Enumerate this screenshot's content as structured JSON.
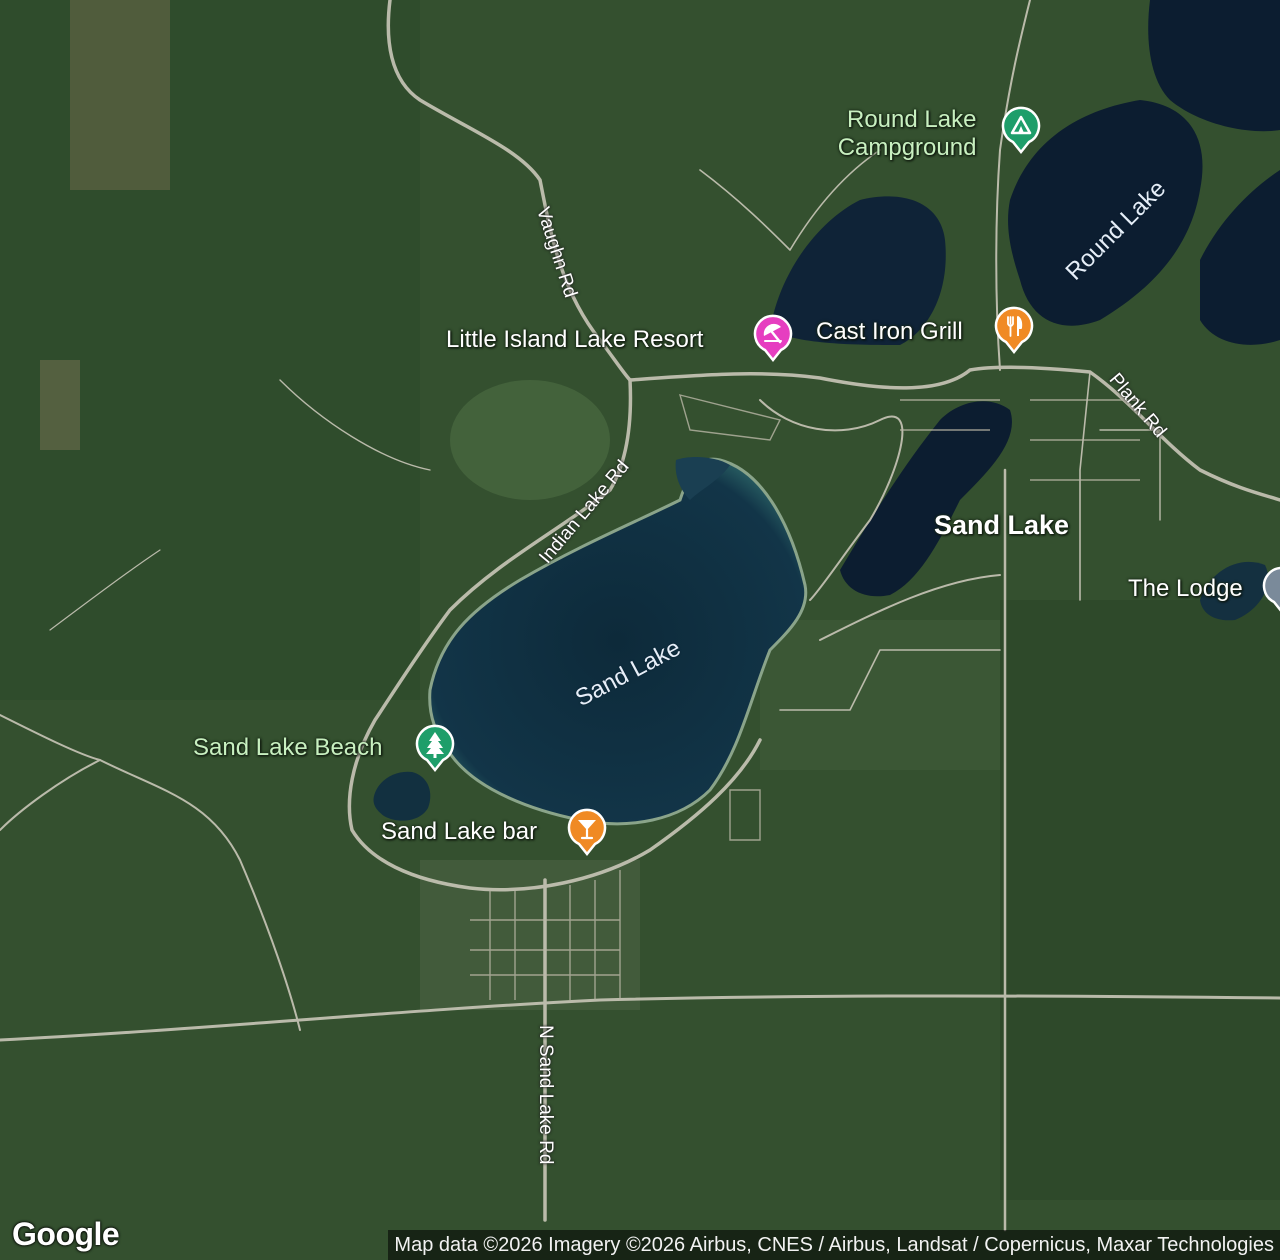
{
  "map": {
    "places": {
      "round_lake_campground_line1": "Round Lake",
      "round_lake_campground_line2": "Campground",
      "little_island_lake_resort": "Little Island Lake Resort",
      "cast_iron_grill": "Cast Iron Grill",
      "sand_lake_town": "Sand Lake",
      "the_lodge": "The Lodge",
      "sand_lake_beach": "Sand Lake Beach",
      "sand_lake_bar": "Sand Lake bar"
    },
    "lakes": {
      "sand_lake": "Sand Lake",
      "round_lake": "Round Lake"
    },
    "roads": {
      "vaughn_rd": "Vaughn Rd",
      "indian_lake_rd": "Indian Lake Rd",
      "plank_rd": "Plank Rd",
      "n_sand_lake_rd": "N Sand Lake Rd"
    },
    "pin_colors": {
      "campground": "#1e9e6a",
      "resort": "#e63ec0",
      "restaurant": "#f08a24",
      "park": "#1e9e6a",
      "bar": "#f08a24",
      "lodging": "#7a8a9a"
    },
    "icons": {
      "campground": "tent-icon",
      "resort": "resort-icon",
      "restaurant": "fork-knife-icon",
      "park": "tree-icon",
      "bar": "cocktail-icon",
      "lodging": "lodging-icon"
    }
  },
  "footer": {
    "logo": "Google",
    "attribution": "Map data ©2026 Imagery ©2026 Airbus, CNES / Airbus, Landsat / Copernicus, Maxar Technologies"
  }
}
